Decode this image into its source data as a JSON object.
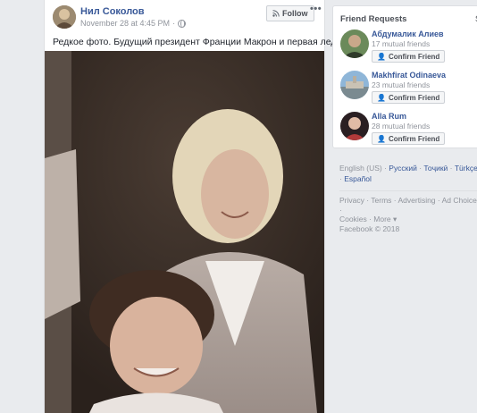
{
  "post": {
    "author": "Нил Соколов",
    "timestamp": "November 28 at 4:45 PM",
    "separator": "·",
    "text": "Редкое фото. Будущий президент Франции Макрон и первая леди",
    "follow_label": "Follow",
    "more_label": "•••"
  },
  "friend_requests": {
    "title": "Friend Requests",
    "see_all": "S",
    "items": [
      {
        "name": "Абдумалик Алиев",
        "mutual": "17 mutual friends",
        "button": "Confirm Friend"
      },
      {
        "name": "Makhfirat Odinaeva",
        "mutual": "23 mutual friends",
        "button": "Confirm Friend"
      },
      {
        "name": "Alla Rum",
        "mutual": "28 mutual friends",
        "button": "Confirm Friend"
      }
    ]
  },
  "languages": {
    "current": "English (US)",
    "sep": " · ",
    "links": [
      "Русский",
      "Тоҷикӣ",
      "Türkçe",
      "Español"
    ]
  },
  "footer": {
    "line1": "Privacy · Terms · Advertising · Ad Choices ·",
    "line2": "Cookies · More ▾",
    "line3": "Facebook © 2018"
  },
  "colors": {
    "link": "#385898",
    "background": "#e9ebee",
    "muted": "#90949c"
  }
}
